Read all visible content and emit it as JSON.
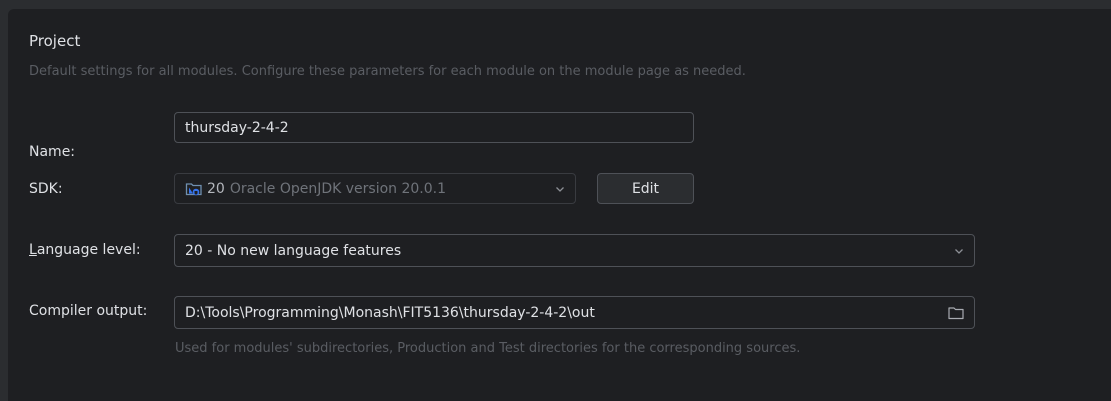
{
  "section": {
    "title": "Project",
    "description": "Default settings for all modules. Configure these parameters for each module on the module page as needed."
  },
  "name": {
    "label": "Name:",
    "value": "thursday-2-4-2"
  },
  "sdk": {
    "label": "SDK:",
    "version": "20",
    "description": "Oracle OpenJDK version 20.0.1",
    "edit_label": "Edit"
  },
  "language_level": {
    "label_mnemonic": "L",
    "label_rest": "anguage level:",
    "value": "20 - No new language features"
  },
  "compiler_output": {
    "label": "Compiler output:",
    "value": "D:\\Tools\\Programming\\Monash\\FIT5136\\thursday-2-4-2\\out",
    "hint": "Used for modules' subdirectories, Production and Test directories for the corresponding sources."
  }
}
